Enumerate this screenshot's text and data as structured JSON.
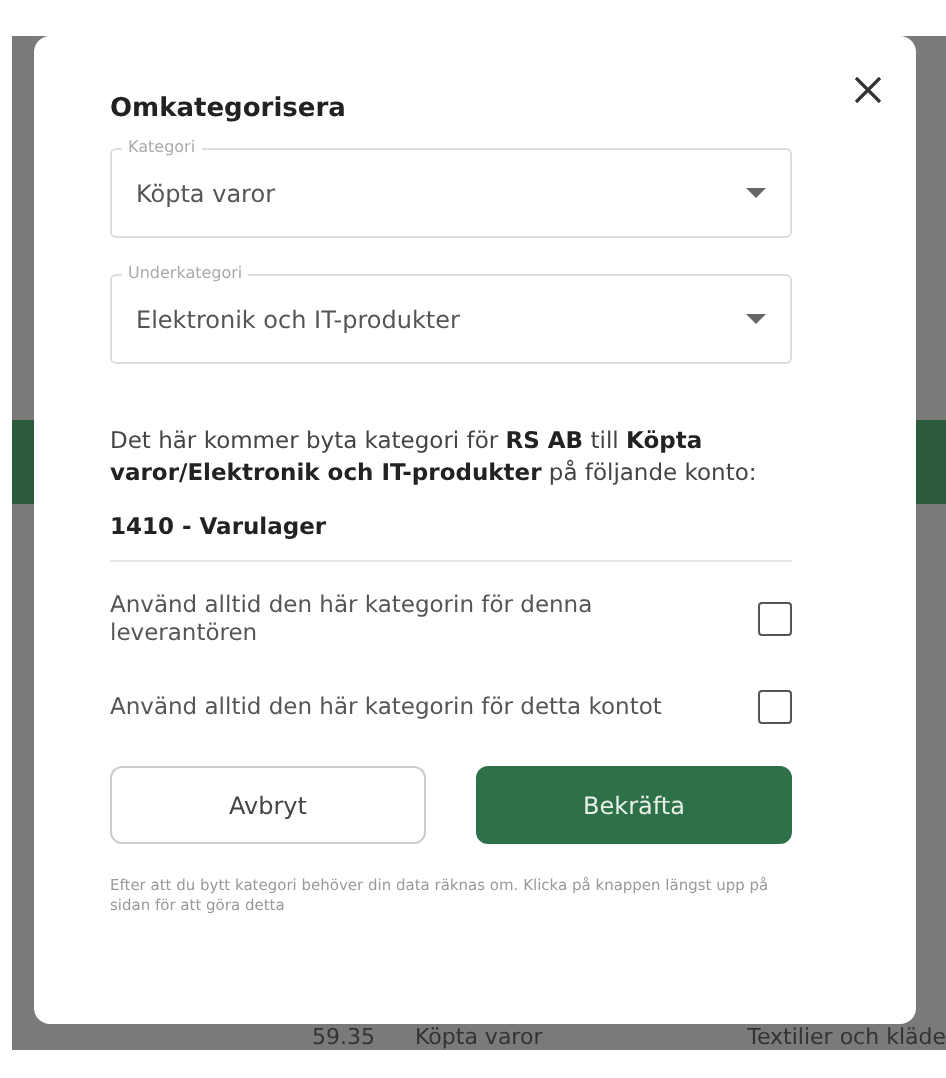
{
  "background": {
    "row": [
      "59.35",
      "Köpta varor",
      "Textilier och kläde"
    ]
  },
  "dialog": {
    "title": "Omkategorisera",
    "fields": [
      {
        "label": "Kategori",
        "value": "Köpta varor"
      },
      {
        "label": "Underkategori",
        "value": "Elektronik och IT-produkter"
      }
    ],
    "message": "Det här kommer byta kategori för **RS AB** till **Köpta varor/Elektronik och IT-produkter** på följande konto:",
    "account": "1410 - Varulager",
    "options": [
      {
        "label": "Använd alltid den här kategorin för denna leverantören",
        "checked": false
      },
      {
        "label": "Använd alltid den här kategorin för detta kontot",
        "checked": false
      }
    ],
    "cancel": "Avbryt",
    "confirm": "Bekräfta",
    "note": "Efter att du bytt kategori behöver din data räknas om. Klicka på knappen längst upp på sidan för att göra detta"
  }
}
